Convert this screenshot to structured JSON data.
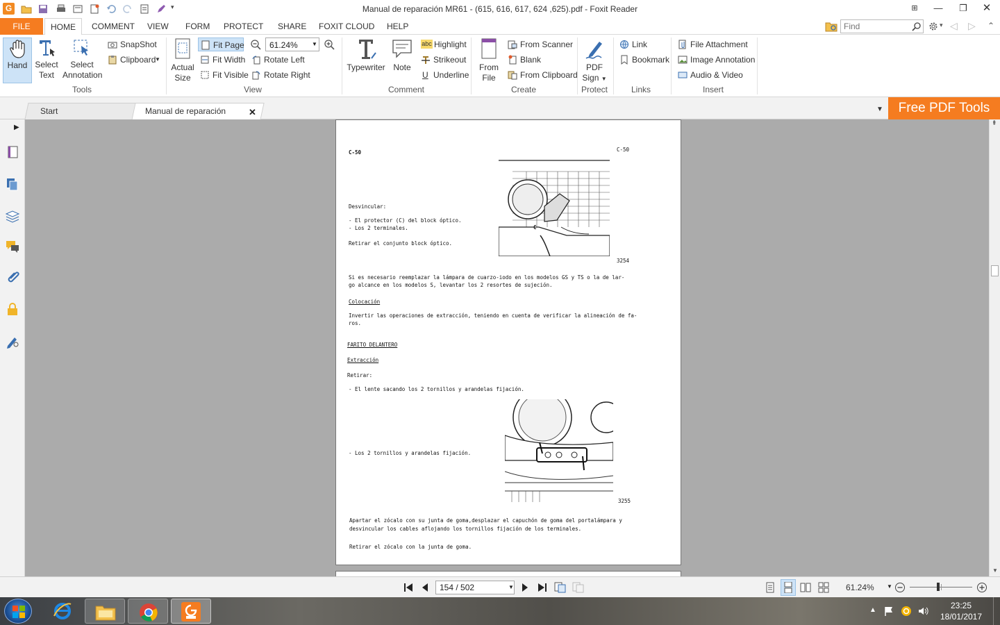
{
  "window": {
    "title": "Manual de reparación MR61 - (615, 616, 617, 624 ,625).pdf - Foxit Reader",
    "app_icon": "G"
  },
  "ribbon_tabs": {
    "file": "FILE",
    "home": "HOME",
    "comment": "COMMENT",
    "view": "VIEW",
    "form": "FORM",
    "protect": "PROTECT",
    "share": "SHARE",
    "foxit_cloud": "FOXIT CLOUD",
    "help": "HELP"
  },
  "search": {
    "placeholder": "Find"
  },
  "tools": {
    "hand": "Hand",
    "select_text_1": "Select",
    "select_text_2": "Text",
    "select_annotation_1": "Select",
    "select_annotation_2": "Annotation",
    "snapshot": "SnapShot",
    "clipboard": "Clipboard",
    "group": "Tools"
  },
  "view": {
    "actual_size_1": "Actual",
    "actual_size_2": "Size",
    "fit_page": "Fit Page",
    "fit_width": "Fit Width",
    "fit_visible": "Fit Visible",
    "zoom_value": "61.24%",
    "rotate_left": "Rotate Left",
    "rotate_right": "Rotate Right",
    "group": "View"
  },
  "comment": {
    "typewriter": "Typewriter",
    "note": "Note",
    "highlight": "Highlight",
    "strikeout": "Strikeout",
    "underline": "Underline",
    "group": "Comment"
  },
  "create": {
    "from_file_1": "From",
    "from_file_2": "File",
    "from_scanner": "From Scanner",
    "blank": "Blank",
    "from_clipboard": "From Clipboard",
    "group": "Create"
  },
  "protect": {
    "pdf_sign_1": "PDF",
    "pdf_sign_2": "Sign",
    "group": "Protect"
  },
  "links": {
    "link": "Link",
    "bookmark": "Bookmark",
    "group": "Links"
  },
  "insert": {
    "file_attachment": "File Attachment",
    "image_annotation": "Image Annotation",
    "audio_video": "Audio & Video",
    "group": "Insert"
  },
  "doc_tabs": {
    "start": "Start",
    "current": "Manual de reparación MR..."
  },
  "promo": {
    "label": "Free PDF Tools"
  },
  "page": {
    "code_left": "C-50",
    "code_right": "C-50",
    "desvincular": "Desvincular:",
    "item1": "- El protector (C) del block óptico.",
    "item2": "- Los 2 terminales.",
    "retirar_conjunto": "Retirar el conjunto block óptico.",
    "fig1": "3254",
    "callout_c": "C",
    "para1_l1": "Si es necesario reemplazar la lámpara de cuarzo-iodo  en los modelos GS y TS o la de lar-",
    "para1_l2": "go alcance en los modelos S,  levantar los 2 resortes de sujeción.",
    "colocacion": "Colocación",
    "para2_l1": "Invertir las operaciones de extracción, teniendo en cuenta de verificar la alineación de fa-",
    "para2_l2": "ros.",
    "farito": "FARITO DELANTERO",
    "extraccion": "Extracción",
    "retirar": "Retirar:",
    "item3": "- El lente sacando los 2 tornillos y arandelas fijación.",
    "item4": "- Los 2 tornillos y arandelas fijación.",
    "fig2": "3255",
    "para3_l1": "Apartar el zócalo con su junta de goma,desplazar el capuchón de goma del portalámpara y",
    "para3_l2": "desvincular los cables aflojando los tornillos fijación de los terminales.",
    "para4": "Retirar el zócalo con la junta de goma."
  },
  "status": {
    "page_indicator": "154 / 502",
    "zoom": "61.24%",
    "zoom_slider_fraction": 0.45
  },
  "taskbar": {
    "time": "23:25",
    "date": "18/01/2017"
  },
  "colors": {
    "accent": "#f57c20",
    "workarea": "#ababab"
  }
}
